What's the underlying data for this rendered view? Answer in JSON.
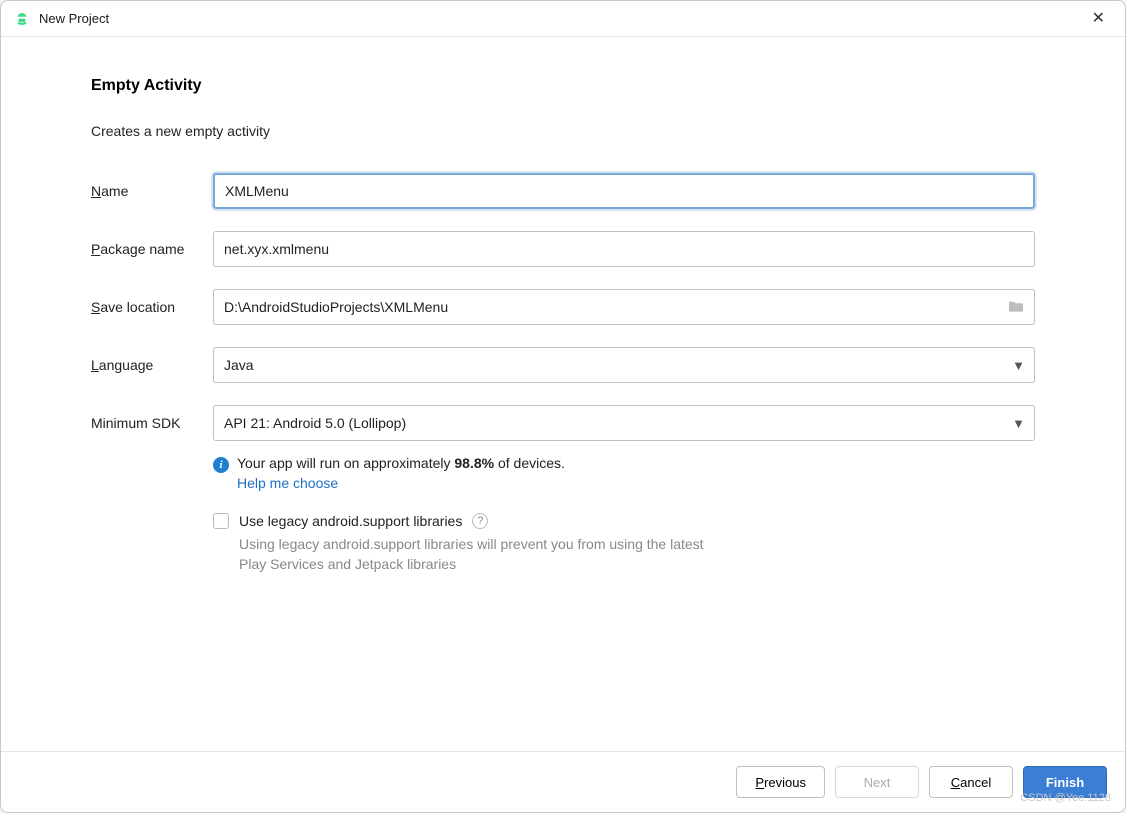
{
  "window": {
    "title": "New Project"
  },
  "page": {
    "heading": "Empty Activity",
    "subtitle": "Creates a new empty activity"
  },
  "form": {
    "name": {
      "label": "Name",
      "value": "XMLMenu"
    },
    "package": {
      "label": "Package name",
      "value": "net.xyx.xmlmenu"
    },
    "save_location": {
      "label": "Save location",
      "value": "D:\\AndroidStudioProjects\\XMLMenu"
    },
    "language": {
      "label": "Language",
      "value": "Java"
    },
    "min_sdk": {
      "label": "Minimum SDK",
      "value": "API 21: Android 5.0 (Lollipop)"
    }
  },
  "info": {
    "text_prefix": "Your app will run on approximately ",
    "percent": "98.8%",
    "text_suffix": " of devices.",
    "help_link": "Help me choose"
  },
  "legacy": {
    "checkbox_label": "Use legacy android.support libraries",
    "note": "Using legacy android.support libraries will prevent you from using the latest Play Services and Jetpack libraries"
  },
  "buttons": {
    "previous": "Previous",
    "next": "Next",
    "cancel": "Cancel",
    "finish": "Finish"
  },
  "watermark": "CSDN @Yee.1128"
}
